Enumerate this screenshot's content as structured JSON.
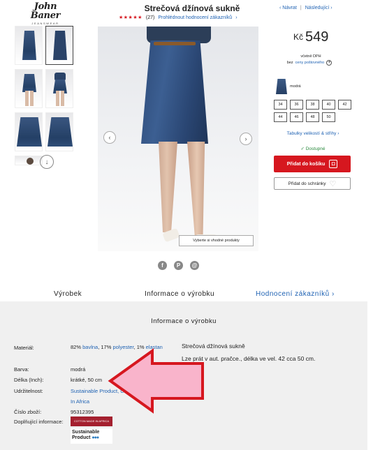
{
  "brand": {
    "name": "John Baner",
    "sub": "JEANSWEAR"
  },
  "product": {
    "title": "Strečová džínová sukně",
    "stars": "★★★★★",
    "review_count": "(27)",
    "review_link": "Prohlédnout hodnocení zákazníků",
    "review_arrow": "›"
  },
  "topnav": {
    "back": "‹ Návrat",
    "sep": "|",
    "next": "Následující ›"
  },
  "gallery": {
    "similar_button": "Vyberte si vhodné produkty",
    "prev": "‹",
    "next": "›",
    "more": "↓"
  },
  "buy": {
    "currency": "Kč",
    "price": "549",
    "vat": "včetně DPH",
    "ship_prefix": "bez",
    "ship_link": "ceny poštovného",
    "plus": "+",
    "color_name": "modrá",
    "sizes": [
      "34",
      "36",
      "38",
      "40",
      "42",
      "44",
      "46",
      "48",
      "50"
    ],
    "size_tables": "Tabulky velikostí & střihy",
    "size_tables_arrow": "›",
    "stock": "✓ Dostupné",
    "cart": "Přidat do košíku",
    "wishlist": "Přidat do schránky"
  },
  "share": {
    "facebook": "f",
    "pinterest": "P",
    "email": "@"
  },
  "tabs": [
    "Výrobek",
    "Informace o výrobku",
    "Hodnocení zákazníků"
  ],
  "tab_arrow": "›",
  "info": {
    "title": "Informace o výrobku",
    "labels": {
      "material": "Materiál:",
      "color": "Barva:",
      "length": "Délka (Inch):",
      "sustain": "Udržitelnost:",
      "number": "Číslo zboží:",
      "extra": "Doplňující informace:"
    },
    "material_pct1": "82%",
    "material_cotton": "bavlna",
    "material_pct2": ", 17%",
    "material_poly": "polyester",
    "material_pct3": ", 1%",
    "material_elastan": "elastan",
    "color": "modrá",
    "length": "krátké, 50 cm",
    "sustain_a": "Sustainable Product, Co",
    "sustain_b": "In Africa",
    "number": "95312395",
    "badge_cotton": "COTTON MADE IN AFRICA",
    "badge_sust1": "Sustainable",
    "badge_sust2": "Product",
    "desc_title": "Strečová džínová sukně",
    "desc_body": "Lze prát v aut. pračce., délka ve vel. 42 cca 50 cm."
  },
  "colors": {
    "accent": "#d6171f",
    "link": "#1f62b3",
    "arrow_fill": "#f9b4cb",
    "arrow_stroke": "#d6171f"
  }
}
